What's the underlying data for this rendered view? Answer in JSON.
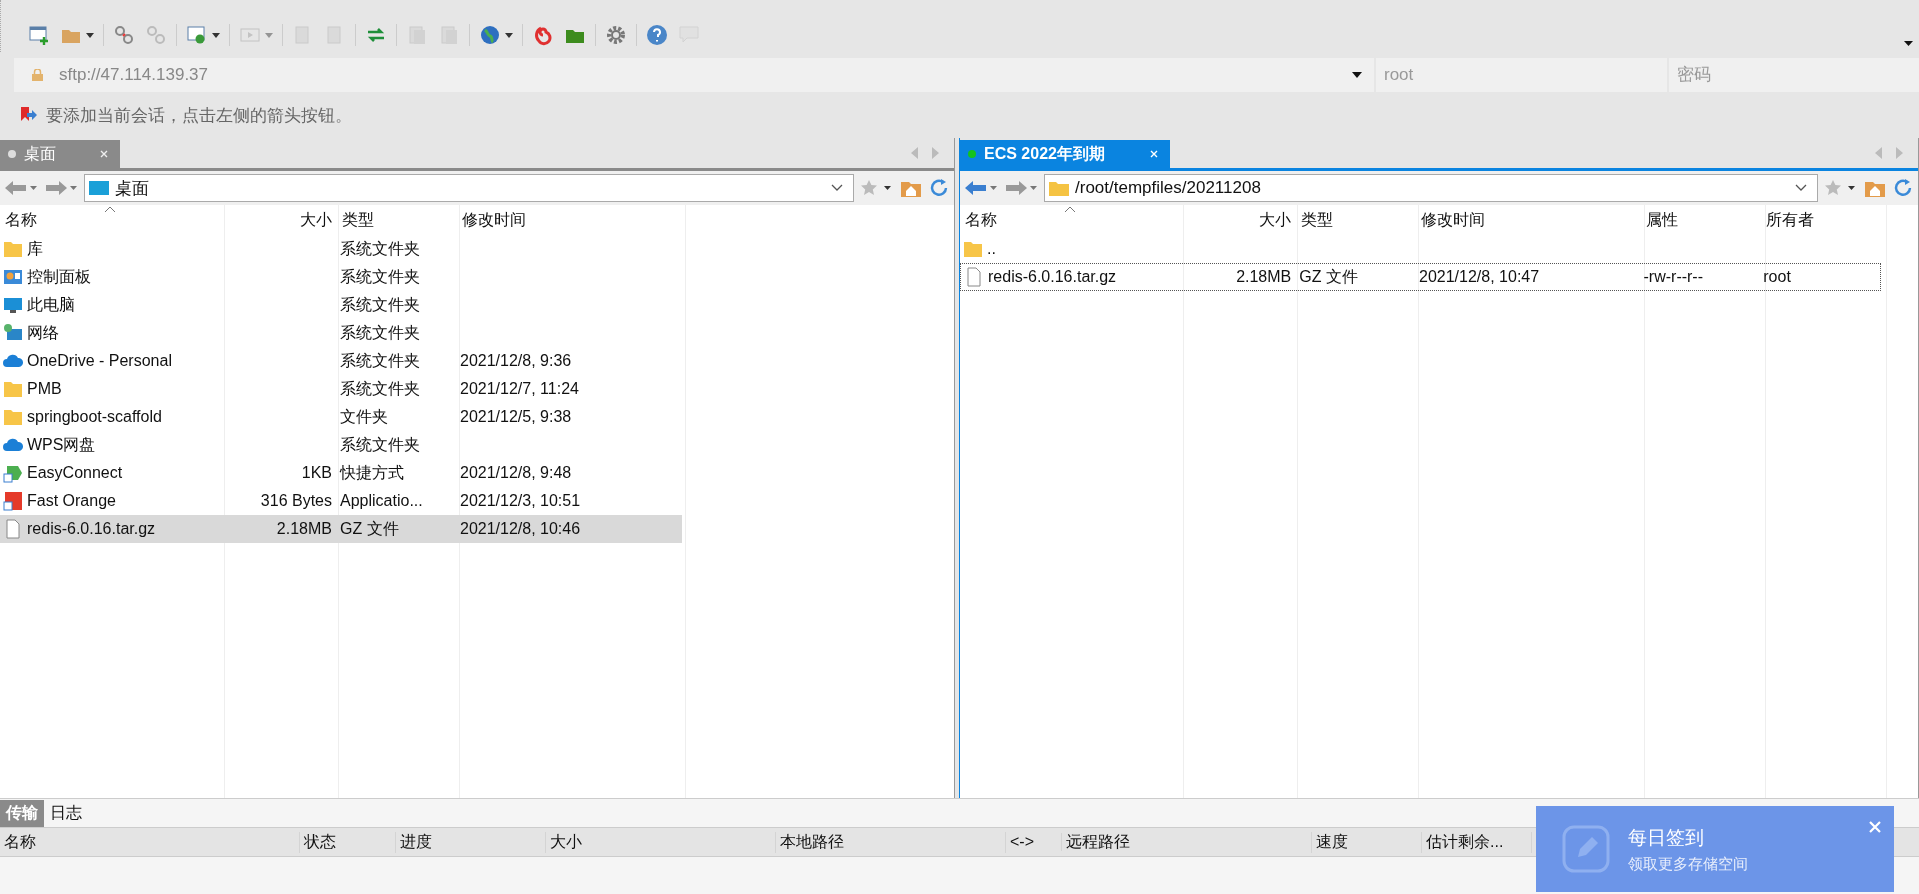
{
  "toolbar": [
    {
      "kind": "new",
      "disabled": false,
      "dropdown": false
    },
    {
      "kind": "open",
      "disabled": false,
      "dropdown": true
    },
    {
      "kind": "sep"
    },
    {
      "kind": "unlink",
      "disabled": false,
      "dropdown": false
    },
    {
      "kind": "link",
      "disabled": true,
      "dropdown": false
    },
    {
      "kind": "sep"
    },
    {
      "kind": "settings",
      "disabled": false,
      "dropdown": true
    },
    {
      "kind": "sep"
    },
    {
      "kind": "play",
      "disabled": true,
      "dropdown": true
    },
    {
      "kind": "sep"
    },
    {
      "kind": "upload",
      "disabled": true,
      "dropdown": false
    },
    {
      "kind": "download",
      "disabled": true,
      "dropdown": false
    },
    {
      "kind": "sep"
    },
    {
      "kind": "sync",
      "disabled": false,
      "dropdown": false
    },
    {
      "kind": "sep"
    },
    {
      "kind": "copy",
      "disabled": true,
      "dropdown": false
    },
    {
      "kind": "paste",
      "disabled": true,
      "dropdown": false
    },
    {
      "kind": "sep"
    },
    {
      "kind": "globe",
      "disabled": false,
      "dropdown": true
    },
    {
      "kind": "sep"
    },
    {
      "kind": "spiral",
      "disabled": false,
      "dropdown": false
    },
    {
      "kind": "app",
      "disabled": false,
      "dropdown": false
    },
    {
      "kind": "sep"
    },
    {
      "kind": "gear",
      "disabled": false,
      "dropdown": false
    },
    {
      "kind": "sep"
    },
    {
      "kind": "help",
      "disabled": false,
      "dropdown": false
    },
    {
      "kind": "chat",
      "disabled": true,
      "dropdown": false
    }
  ],
  "address": {
    "value": "sftp://47.114.139.37",
    "user_placeholder": "root",
    "password_placeholder": "密码"
  },
  "hint": "要添加当前会话，点击左侧的箭头按钮。",
  "panels": [
    {
      "tab": {
        "label": "桌面",
        "selected": false
      },
      "path": {
        "text": "桌面",
        "kind": "desktop"
      },
      "columns": [
        "名称",
        "大小",
        "类型",
        "修改时间"
      ],
      "rows": [
        {
          "kind": "folder",
          "name": "库",
          "type": "系统文件夹",
          "selected": false
        },
        {
          "kind": "control",
          "name": "控制面板",
          "type": "系统文件夹",
          "selected": false
        },
        {
          "kind": "pc",
          "name": "此电脑",
          "type": "系统文件夹",
          "selected": false
        },
        {
          "kind": "network",
          "name": "网络",
          "type": "系统文件夹",
          "selected": false
        },
        {
          "kind": "cloud",
          "name": "OneDrive - Personal",
          "type": "系统文件夹",
          "modified": "2021/12/8, 9:36",
          "selected": false
        },
        {
          "kind": "folder",
          "name": "PMB",
          "type": "系统文件夹",
          "modified": "2021/12/7, 11:24",
          "selected": false
        },
        {
          "kind": "folder",
          "name": "springboot-scaffold",
          "type": "文件夹",
          "modified": "2021/12/5, 9:38",
          "selected": false
        },
        {
          "kind": "cloud",
          "name": "WPS网盘",
          "type": "系统文件夹",
          "selected": false
        },
        {
          "kind": "shortcut",
          "name": "EasyConnect",
          "size": "1KB",
          "type": "快捷方式",
          "modified": "2021/12/8, 9:48",
          "selected": false
        },
        {
          "kind": "app",
          "name": "Fast Orange",
          "size": "316 Bytes",
          "type": "Applicatio...",
          "modified": "2021/12/3, 10:51",
          "selected": false
        },
        {
          "kind": "file",
          "name": "redis-6.0.16.tar.gz",
          "size": "2.18MB",
          "type": "GZ 文件",
          "modified": "2021/12/8, 10:46",
          "selected": true
        }
      ]
    },
    {
      "tab": {
        "label": "ECS 2022年到期",
        "selected": true
      },
      "path": {
        "text": "/root/tempfiles/20211208",
        "kind": "folder"
      },
      "columns": [
        "名称",
        "大小",
        "类型",
        "修改时间",
        "属性",
        "所有者"
      ],
      "rows": [
        {
          "kind": "folder",
          "name": "..",
          "selected": false,
          "focused": false
        },
        {
          "kind": "file",
          "name": "redis-6.0.16.tar.gz",
          "size": "2.18MB",
          "type": "GZ 文件",
          "modified": "2021/12/8, 10:47",
          "rights": "-rw-r--r--",
          "owner": "root",
          "selected": false,
          "focused": true
        }
      ]
    }
  ],
  "bottom_tabs": [
    {
      "label": "传输",
      "selected": true
    },
    {
      "label": "日志",
      "selected": false
    }
  ],
  "transfer_columns": [
    "名称",
    "状态",
    "进度",
    "大小",
    "本地路径",
    "<->",
    "远程路径",
    "速度",
    "估计剩余..."
  ],
  "popup": {
    "title": "每日签到",
    "subtitle": "领取更多存储空间"
  }
}
